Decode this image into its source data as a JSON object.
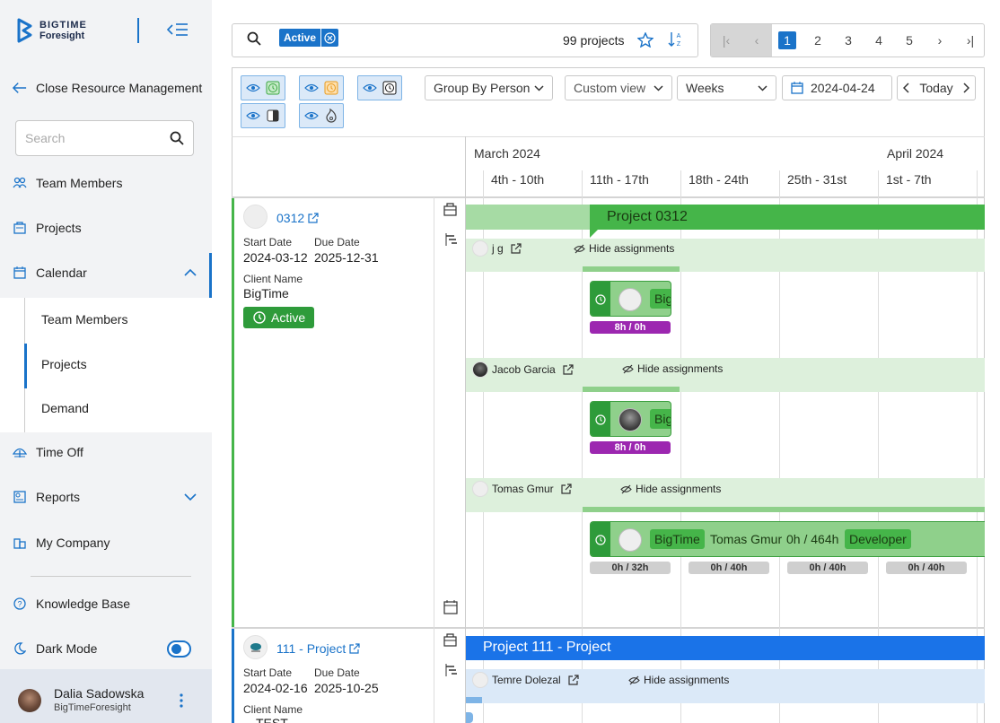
{
  "app": {
    "brand_line1": "BIGTIME",
    "brand_line2": "Foresight"
  },
  "sidebar": {
    "back_label": "Close Resource Management",
    "search_placeholder": "Search",
    "items": {
      "team_members": "Team Members",
      "projects": "Projects",
      "calendar": "Calendar",
      "time_off": "Time Off",
      "reports": "Reports",
      "my_company": "My Company",
      "knowledge_base": "Knowledge Base",
      "dark_mode": "Dark Mode"
    },
    "calendar_sub": [
      "Team Members",
      "Projects",
      "Demand"
    ],
    "user": {
      "name": "Dalia Sadowska",
      "org": "BigTimeForesight"
    }
  },
  "toolbar": {
    "filter_chip": "Active",
    "project_count": "99 projects",
    "pages": [
      "1",
      "2",
      "3",
      "4",
      "5"
    ],
    "current_page": "1"
  },
  "controls": {
    "group_by": "Group By Person",
    "custom_view": "Custom view",
    "range": "Weeks",
    "date": "2024-04-24",
    "today": "Today"
  },
  "timeline": {
    "months": [
      "March 2024",
      "April 2024"
    ],
    "weeks": [
      "4th - 10th",
      "11th - 17th",
      "18th - 24th",
      "25th - 31st",
      "1st - 7th"
    ]
  },
  "projects": [
    {
      "code": "0312",
      "bar_title": "Project 0312",
      "start_label": "Start Date",
      "start": "2024-03-12",
      "due_label": "Due Date",
      "due": "2025-12-31",
      "client_label": "Client Name",
      "client": "BigTime",
      "status": "Active",
      "people": [
        {
          "name": "j g",
          "hide": "Hide assignments",
          "tag": "Big",
          "hours": "8h / 0h"
        },
        {
          "name": "Jacob Garcia",
          "hide": "Hide assignments",
          "tag": "Big",
          "hours": "8h / 0h"
        },
        {
          "name": "Tomas Gmur",
          "hide": "Hide assignments",
          "tag": "BigTime",
          "inline_name": "Tomas Gmur",
          "inline_hours": "0h / 464h",
          "role": "Developer",
          "weekly": [
            "0h / 32h",
            "0h / 40h",
            "0h / 40h",
            "0h / 40h"
          ]
        }
      ]
    },
    {
      "code": "111 - Project",
      "bar_title": "Project 111 - Project",
      "start_label": "Start Date",
      "start": "2024-02-16",
      "due_label": "Due Date",
      "due": "2025-10-25",
      "client_label": "Client Name",
      "client": "TEST",
      "people": [
        {
          "name": "Temre Dolezal",
          "hide": "Hide assignments"
        }
      ]
    }
  ],
  "colors": {
    "accent": "#1a73c9",
    "green": "#45b549",
    "purple": "#9c27b0"
  }
}
